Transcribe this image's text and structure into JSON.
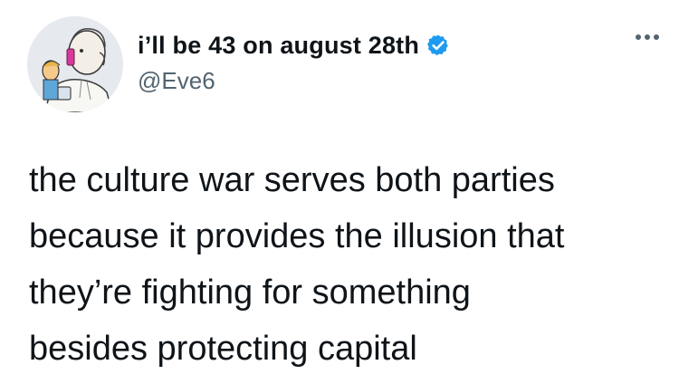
{
  "tweet": {
    "author": {
      "display_name": "i’ll be 43 on august 28th",
      "handle": "@Eve6",
      "verified": true,
      "avatar_icon": "sketch-portrait-avatar",
      "verified_color": "#1d9bf0"
    },
    "menu_icon": "more-horizontal-icon",
    "text_lines": [
      "the culture war serves both parties",
      "because it provides the illusion that",
      "they’re fighting for something",
      "besides protecting capital"
    ]
  }
}
